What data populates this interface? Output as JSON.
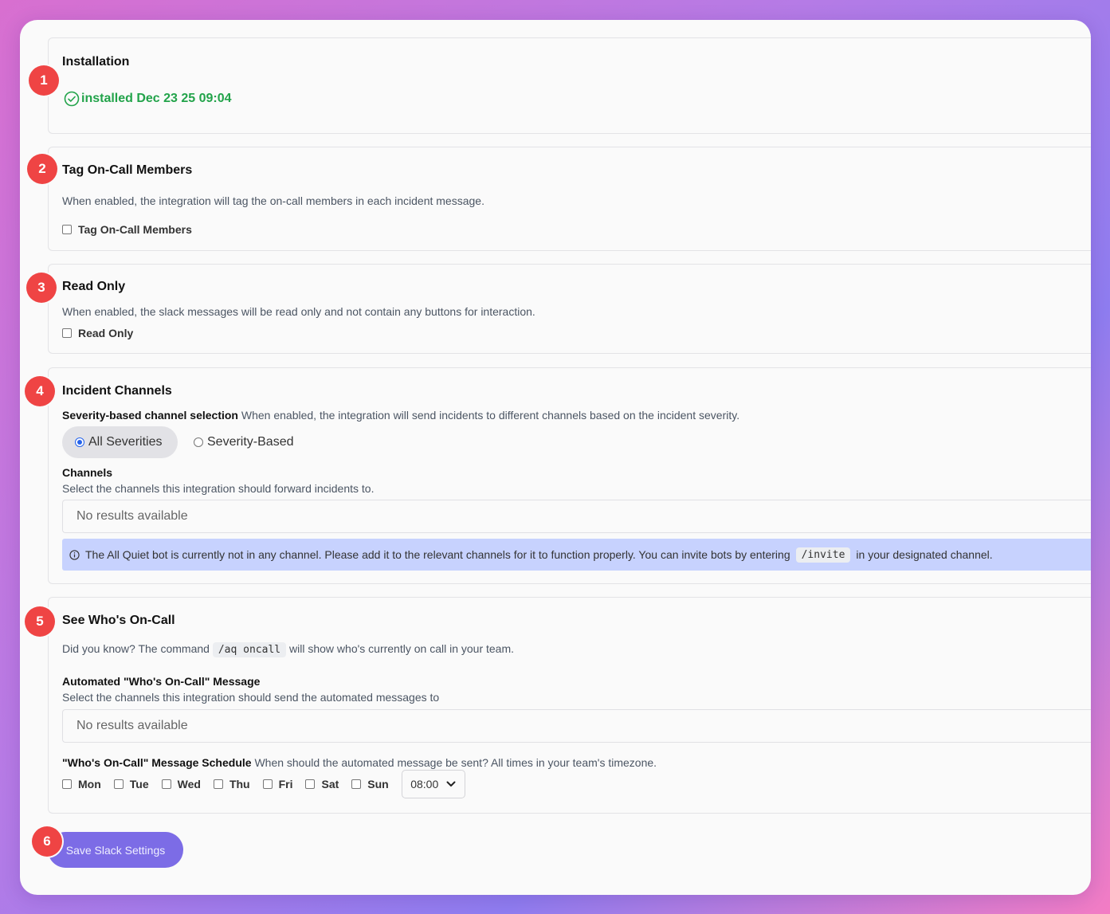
{
  "installation": {
    "badge": "1",
    "title": "Installation",
    "status": "installed Dec 23 25 09:04",
    "status_color": "#22a34a"
  },
  "tag_oncall": {
    "badge": "2",
    "title": "Tag On-Call Members",
    "description": "When enabled, the integration will tag the on-call members in each incident message.",
    "checkbox_label": "Tag On-Call Members"
  },
  "read_only": {
    "badge": "3",
    "title": "Read Only",
    "description": "When enabled, the slack messages will be read only and not contain any buttons for interaction.",
    "checkbox_label": "Read Only"
  },
  "incident_channels": {
    "badge": "4",
    "title": "Incident Channels",
    "severity_label": "Severity-based channel selection",
    "severity_description": "When enabled, the integration will send incidents to different channels based on the incident severity.",
    "option_all": "All Severities",
    "option_severity": "Severity-Based",
    "channels_label": "Channels",
    "channels_description": "Select the channels this integration should forward incidents to.",
    "channels_placeholder": "No results available",
    "info_before": "The All Quiet bot is currently not in any channel. Please add it to the relevant channels for it to function properly. You can invite bots by entering",
    "info_code": "/invite",
    "info_after": "in your designated channel."
  },
  "who_oncall": {
    "badge": "5",
    "title": "See Who's On-Call",
    "tip_before": "Did you know? The command",
    "tip_code": "/aq oncall",
    "tip_after": "will show who's currently on call in your team.",
    "automated_label": "Automated \"Who's On-Call\" Message",
    "automated_description": "Select the channels this integration should send the automated messages to",
    "automated_placeholder": "No results available",
    "schedule_label": "\"Who's On-Call\" Message Schedule",
    "schedule_description": "When should the automated message be sent? All times in your team's timezone.",
    "days": [
      "Mon",
      "Tue",
      "Wed",
      "Thu",
      "Fri",
      "Sat",
      "Sun"
    ],
    "time": "08:00"
  },
  "save": {
    "badge": "6",
    "label": "Save Slack Settings",
    "color": "#7c6ce6"
  }
}
